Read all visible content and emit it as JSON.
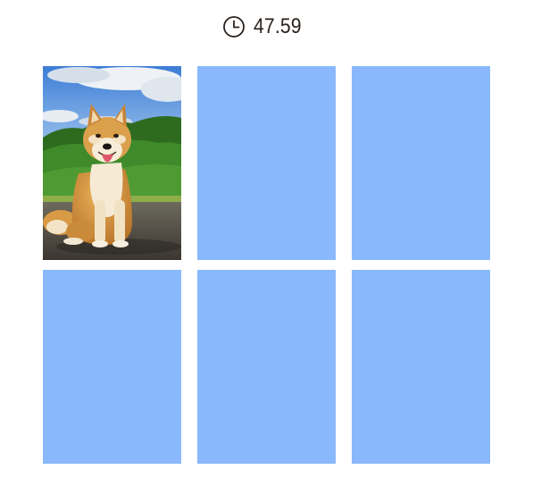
{
  "timer": {
    "icon": "clock-icon",
    "value": "47.59"
  },
  "board": {
    "rows": 2,
    "columns": 3,
    "card_back_color": "#89b8fd",
    "cards": [
      {
        "state": "face-up",
        "image": "shiba-inu-dog-photo"
      },
      {
        "state": "face-down"
      },
      {
        "state": "face-down"
      },
      {
        "state": "face-down"
      },
      {
        "state": "face-down"
      },
      {
        "state": "face-down"
      }
    ]
  }
}
